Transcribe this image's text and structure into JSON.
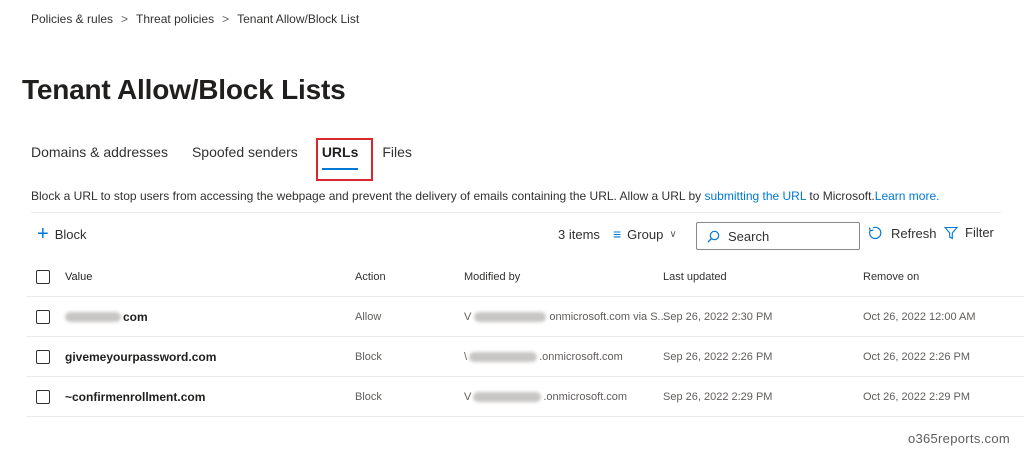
{
  "breadcrumb": {
    "items": [
      "Policies & rules",
      "Threat policies",
      "Tenant Allow/Block List"
    ],
    "separator": ">"
  },
  "page": {
    "title": "Tenant Allow/Block Lists"
  },
  "tabs": [
    {
      "label": "Domains & addresses",
      "active": false
    },
    {
      "label": "Spoofed senders",
      "active": false
    },
    {
      "label": "URLs",
      "active": true
    },
    {
      "label": "Files",
      "active": false
    }
  ],
  "description": {
    "text": "Block a URL to stop users from accessing the webpage and prevent the delivery of emails containing the URL. Allow a URL by ",
    "link_submit": "submitting the URL",
    "middle": " to Microsoft.",
    "link_learn": "Learn more."
  },
  "toolbar": {
    "block_label": "Block",
    "item_count": "3 items",
    "group_label": "Group",
    "search_placeholder": "Search",
    "refresh_label": "Refresh",
    "filter_label": "Filter"
  },
  "table": {
    "columns": [
      "Value",
      "Action",
      "Modified by",
      "Last updated",
      "Remove on"
    ],
    "rows": [
      {
        "value": "com",
        "action": "Allow",
        "modified_by": "onmicrosoft.com via S...",
        "last_updated": "Sep 26, 2022 2:30 PM",
        "remove_on": "Oct 26, 2022 12:00 AM"
      },
      {
        "value": "givemeyourpassword.com",
        "action": "Block",
        "modified_by": ".onmicrosoft.com",
        "last_updated": "Sep 26, 2022 2:26 PM",
        "remove_on": "Oct 26, 2022 2:26 PM"
      },
      {
        "value": "~confirmenrollment.com",
        "action": "Block",
        "modified_by": ".onmicrosoft.com",
        "last_updated": "Sep 26, 2022 2:29 PM",
        "remove_on": "Oct 26, 2022 2:29 PM"
      }
    ]
  },
  "watermark": "o365reports.com",
  "colors": {
    "accent": "#0078d4",
    "highlight_box": "#d9272e"
  }
}
